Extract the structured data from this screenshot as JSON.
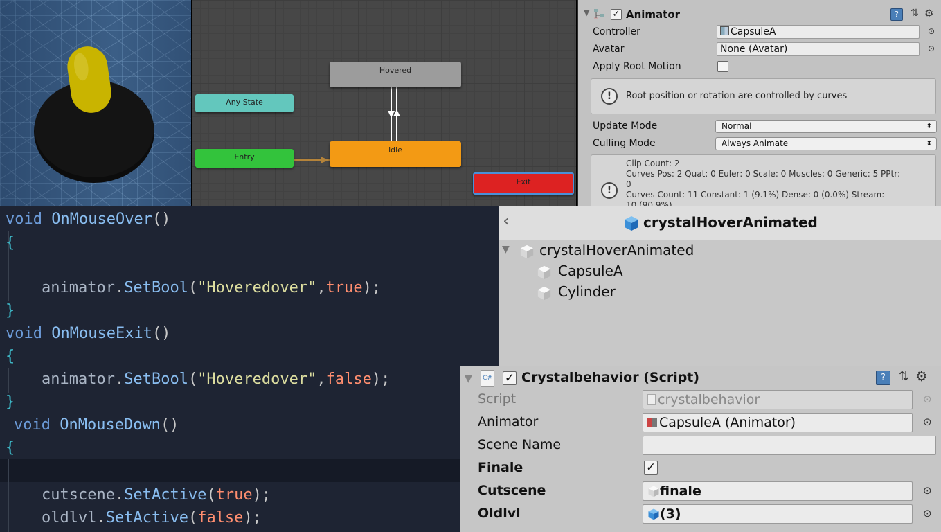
{
  "graph": {
    "nodes": {
      "hovered": "Hovered",
      "any_state": "Any State",
      "entry": "Entry",
      "idle": "idle",
      "exit": "Exit"
    },
    "colors": {
      "hovered": "#9c9c9c",
      "any_state": "#63c7bd",
      "entry": "#33c33c",
      "idle": "#f39a14",
      "exit": "#dd2222"
    }
  },
  "animator": {
    "title": "Animator",
    "enabled": true,
    "controller_label": "Controller",
    "controller_value": "CapsuleA",
    "avatar_label": "Avatar",
    "avatar_value": "None (Avatar)",
    "apply_root_motion_label": "Apply Root Motion",
    "apply_root_motion": false,
    "help_text": "Root position or rotation are controlled by curves",
    "update_mode_label": "Update Mode",
    "update_mode_value": "Normal",
    "culling_mode_label": "Culling Mode",
    "culling_mode_value": "Always Animate",
    "info": {
      "line1": "Clip Count: 2",
      "line2": "Curves Pos: 2 Quat: 0 Euler: 0 Scale: 0 Muscles: 0 Generic: 5 PPtr:",
      "line3": "0",
      "line4": "Curves Count: 11 Constant: 1 (9.1%) Dense: 0 (0.0%) Stream:",
      "line5": "10 (90.9%)"
    }
  },
  "code": {
    "l1_kw": "void",
    "l1_fn": "OnMouseOver",
    "l1_pun": "()",
    "l2": "{",
    "l4_id": "animator",
    "l4_dot": ".",
    "l4_fn": "SetBool",
    "l4_open": "(",
    "l4_str": "\"Hoveredover\"",
    "l4_comma": ",",
    "l4_lit": "true",
    "l4_close": ");",
    "l5": "}",
    "l6_kw": "void",
    "l6_fn": "OnMouseExit",
    "l6_pun": "()",
    "l7": "{",
    "l8_id": "animator",
    "l8_dot": ".",
    "l8_fn": "SetBool",
    "l8_open": "(",
    "l8_str": "\"Hoveredover\"",
    "l8_comma": ",",
    "l8_lit": "false",
    "l8_close": ");",
    "l9": "}",
    "l10_kw": "void",
    "l10_fn": "OnMouseDown",
    "l10_pun": "()",
    "l11": "{",
    "l13_id": "cutscene",
    "l13_dot": ".",
    "l13_fn": "SetActive",
    "l13_open": "(",
    "l13_lit": "true",
    "l13_close": ");",
    "l14_id": "oldlvl",
    "l14_dot": ".",
    "l14_fn": "SetActive",
    "l14_open": "(",
    "l14_lit": "false",
    "l14_close": ");"
  },
  "hierarchy": {
    "back": "‹",
    "title": "crystalHoverAnimated",
    "root": "crystalHoverAnimated",
    "children": [
      "CapsuleA",
      "Cylinder"
    ]
  },
  "script_component": {
    "title": "Crystalbehavior (Script)",
    "enabled": true,
    "script_label": "Script",
    "script_value": "crystalbehavior",
    "animator_label": "Animator",
    "animator_value": "CapsuleA (Animator)",
    "scene_name_label": "Scene Name",
    "scene_name_value": "",
    "finale_label": "Finale",
    "finale": true,
    "cutscene_label": "Cutscene",
    "cutscene_value": "finale",
    "oldlvl_label": "Oldlvl",
    "oldlvl_value": "(3)"
  },
  "icons": [
    "foldout-arrow-icon",
    "animator-component-icon",
    "help-book-icon",
    "preset-icon",
    "gear-icon",
    "object-picker-icon",
    "warning-icon",
    "cube-icon",
    "csharp-script-icon"
  ]
}
